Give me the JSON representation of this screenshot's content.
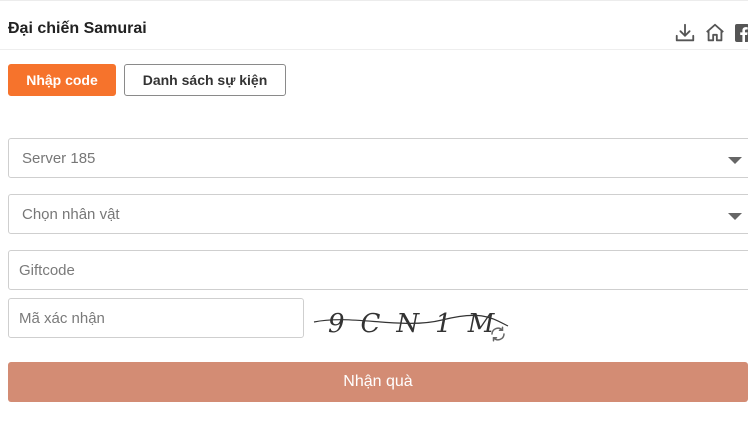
{
  "header": {
    "title": "Đại chiến Samurai",
    "icons": [
      "download-icon",
      "home-icon",
      "facebook-icon"
    ]
  },
  "tabs": [
    {
      "label": "Nhập code",
      "active": true
    },
    {
      "label": "Danh sách sự kiện",
      "active": false
    }
  ],
  "form": {
    "server_select": {
      "value": "Server 185"
    },
    "character_select": {
      "value": "Chọn nhân vật"
    },
    "giftcode": {
      "placeholder": "Giftcode",
      "value": ""
    },
    "captcha_input": {
      "placeholder": "Mã xác nhận",
      "value": ""
    },
    "captcha_text": "9CN1M",
    "submit_label": "Nhận quà"
  },
  "colors": {
    "accent": "#f6732c",
    "submit": "#d38c74",
    "border": "#cfcfcf"
  }
}
